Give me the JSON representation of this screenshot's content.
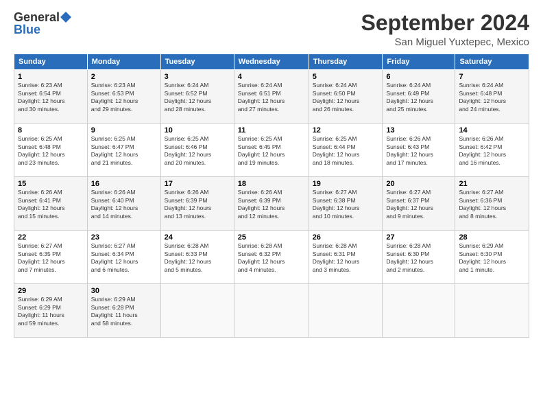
{
  "logo": {
    "line1": "General",
    "line2": "Blue"
  },
  "title": "September 2024",
  "location": "San Miguel Yuxtepec, Mexico",
  "days_header": [
    "Sunday",
    "Monday",
    "Tuesday",
    "Wednesday",
    "Thursday",
    "Friday",
    "Saturday"
  ],
  "weeks": [
    [
      {
        "day": "1",
        "info": "Sunrise: 6:23 AM\nSunset: 6:54 PM\nDaylight: 12 hours\nand 30 minutes."
      },
      {
        "day": "2",
        "info": "Sunrise: 6:23 AM\nSunset: 6:53 PM\nDaylight: 12 hours\nand 29 minutes."
      },
      {
        "day": "3",
        "info": "Sunrise: 6:24 AM\nSunset: 6:52 PM\nDaylight: 12 hours\nand 28 minutes."
      },
      {
        "day": "4",
        "info": "Sunrise: 6:24 AM\nSunset: 6:51 PM\nDaylight: 12 hours\nand 27 minutes."
      },
      {
        "day": "5",
        "info": "Sunrise: 6:24 AM\nSunset: 6:50 PM\nDaylight: 12 hours\nand 26 minutes."
      },
      {
        "day": "6",
        "info": "Sunrise: 6:24 AM\nSunset: 6:49 PM\nDaylight: 12 hours\nand 25 minutes."
      },
      {
        "day": "7",
        "info": "Sunrise: 6:24 AM\nSunset: 6:48 PM\nDaylight: 12 hours\nand 24 minutes."
      }
    ],
    [
      {
        "day": "8",
        "info": "Sunrise: 6:25 AM\nSunset: 6:48 PM\nDaylight: 12 hours\nand 23 minutes."
      },
      {
        "day": "9",
        "info": "Sunrise: 6:25 AM\nSunset: 6:47 PM\nDaylight: 12 hours\nand 21 minutes."
      },
      {
        "day": "10",
        "info": "Sunrise: 6:25 AM\nSunset: 6:46 PM\nDaylight: 12 hours\nand 20 minutes."
      },
      {
        "day": "11",
        "info": "Sunrise: 6:25 AM\nSunset: 6:45 PM\nDaylight: 12 hours\nand 19 minutes."
      },
      {
        "day": "12",
        "info": "Sunrise: 6:25 AM\nSunset: 6:44 PM\nDaylight: 12 hours\nand 18 minutes."
      },
      {
        "day": "13",
        "info": "Sunrise: 6:26 AM\nSunset: 6:43 PM\nDaylight: 12 hours\nand 17 minutes."
      },
      {
        "day": "14",
        "info": "Sunrise: 6:26 AM\nSunset: 6:42 PM\nDaylight: 12 hours\nand 16 minutes."
      }
    ],
    [
      {
        "day": "15",
        "info": "Sunrise: 6:26 AM\nSunset: 6:41 PM\nDaylight: 12 hours\nand 15 minutes."
      },
      {
        "day": "16",
        "info": "Sunrise: 6:26 AM\nSunset: 6:40 PM\nDaylight: 12 hours\nand 14 minutes."
      },
      {
        "day": "17",
        "info": "Sunrise: 6:26 AM\nSunset: 6:39 PM\nDaylight: 12 hours\nand 13 minutes."
      },
      {
        "day": "18",
        "info": "Sunrise: 6:26 AM\nSunset: 6:39 PM\nDaylight: 12 hours\nand 12 minutes."
      },
      {
        "day": "19",
        "info": "Sunrise: 6:27 AM\nSunset: 6:38 PM\nDaylight: 12 hours\nand 10 minutes."
      },
      {
        "day": "20",
        "info": "Sunrise: 6:27 AM\nSunset: 6:37 PM\nDaylight: 12 hours\nand 9 minutes."
      },
      {
        "day": "21",
        "info": "Sunrise: 6:27 AM\nSunset: 6:36 PM\nDaylight: 12 hours\nand 8 minutes."
      }
    ],
    [
      {
        "day": "22",
        "info": "Sunrise: 6:27 AM\nSunset: 6:35 PM\nDaylight: 12 hours\nand 7 minutes."
      },
      {
        "day": "23",
        "info": "Sunrise: 6:27 AM\nSunset: 6:34 PM\nDaylight: 12 hours\nand 6 minutes."
      },
      {
        "day": "24",
        "info": "Sunrise: 6:28 AM\nSunset: 6:33 PM\nDaylight: 12 hours\nand 5 minutes."
      },
      {
        "day": "25",
        "info": "Sunrise: 6:28 AM\nSunset: 6:32 PM\nDaylight: 12 hours\nand 4 minutes."
      },
      {
        "day": "26",
        "info": "Sunrise: 6:28 AM\nSunset: 6:31 PM\nDaylight: 12 hours\nand 3 minutes."
      },
      {
        "day": "27",
        "info": "Sunrise: 6:28 AM\nSunset: 6:30 PM\nDaylight: 12 hours\nand 2 minutes."
      },
      {
        "day": "28",
        "info": "Sunrise: 6:29 AM\nSunset: 6:30 PM\nDaylight: 12 hours\nand 1 minute."
      }
    ],
    [
      {
        "day": "29",
        "info": "Sunrise: 6:29 AM\nSunset: 6:29 PM\nDaylight: 11 hours\nand 59 minutes."
      },
      {
        "day": "30",
        "info": "Sunrise: 6:29 AM\nSunset: 6:28 PM\nDaylight: 11 hours\nand 58 minutes."
      },
      null,
      null,
      null,
      null,
      null
    ]
  ]
}
